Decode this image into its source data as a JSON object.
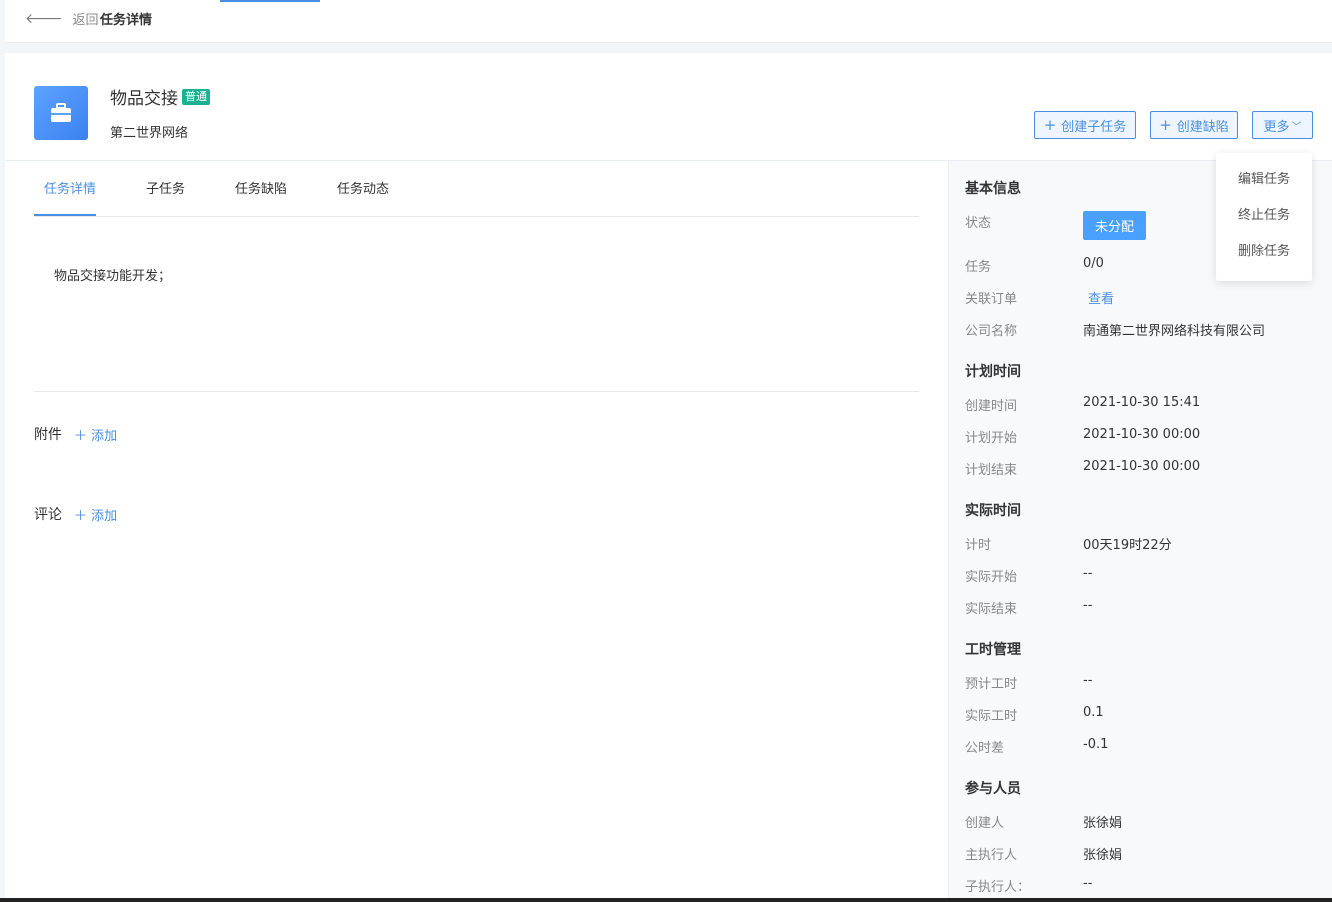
{
  "topbar": {
    "back_label": "返回",
    "breadcrumb": "任务详情"
  },
  "task": {
    "title": "物品交接",
    "priority_badge": "普通",
    "project": "第二世界网络"
  },
  "actions": {
    "create_subtask": "创建子任务",
    "create_defect": "创建缺陷",
    "more": "更多"
  },
  "more_menu": [
    "编辑任务",
    "终止任务",
    "删除任务"
  ],
  "tabs": [
    "任务详情",
    "子任务",
    "任务缺陷",
    "任务动态"
  ],
  "description": "物品交接功能开发；",
  "attachments": {
    "label": "附件",
    "add": "添加"
  },
  "comments": {
    "label": "评论",
    "add": "添加"
  },
  "basic": {
    "heading": "基本信息",
    "status_label": "状态",
    "status_value": "未分配",
    "task_label": "任务",
    "task_value": "0/0",
    "order_label": "关联订单",
    "order_value": "查看",
    "company_label": "公司名称",
    "company_value": "南通第二世界网络科技有限公司"
  },
  "plan": {
    "heading": "计划时间",
    "created_label": "创建时间",
    "created_value": "2021-10-30 15:41",
    "start_label": "计划开始",
    "start_value": "2021-10-30 00:00",
    "end_label": "计划结束",
    "end_value": "2021-10-30 00:00"
  },
  "actual": {
    "heading": "实际时间",
    "timer_label": "计时",
    "timer_value": "00天19时22分",
    "start_label": "实际开始",
    "start_value": "--",
    "end_label": "实际结束",
    "end_value": "--"
  },
  "hours": {
    "heading": "工时管理",
    "est_label": "预计工时",
    "est_value": "--",
    "act_label": "实际工时",
    "act_value": "0.1",
    "diff_label": "公时差",
    "diff_value": "-0.1"
  },
  "people": {
    "heading": "参与人员",
    "creator_label": "创建人",
    "creator_value": "张徐娟",
    "owner_label": "主执行人",
    "owner_value": "张徐娟",
    "sub_label": "子执行人：",
    "sub_value": "--"
  },
  "colors": {
    "accent": "#4a90e2",
    "badge": "#19b394",
    "status": "#4aa0ff"
  }
}
